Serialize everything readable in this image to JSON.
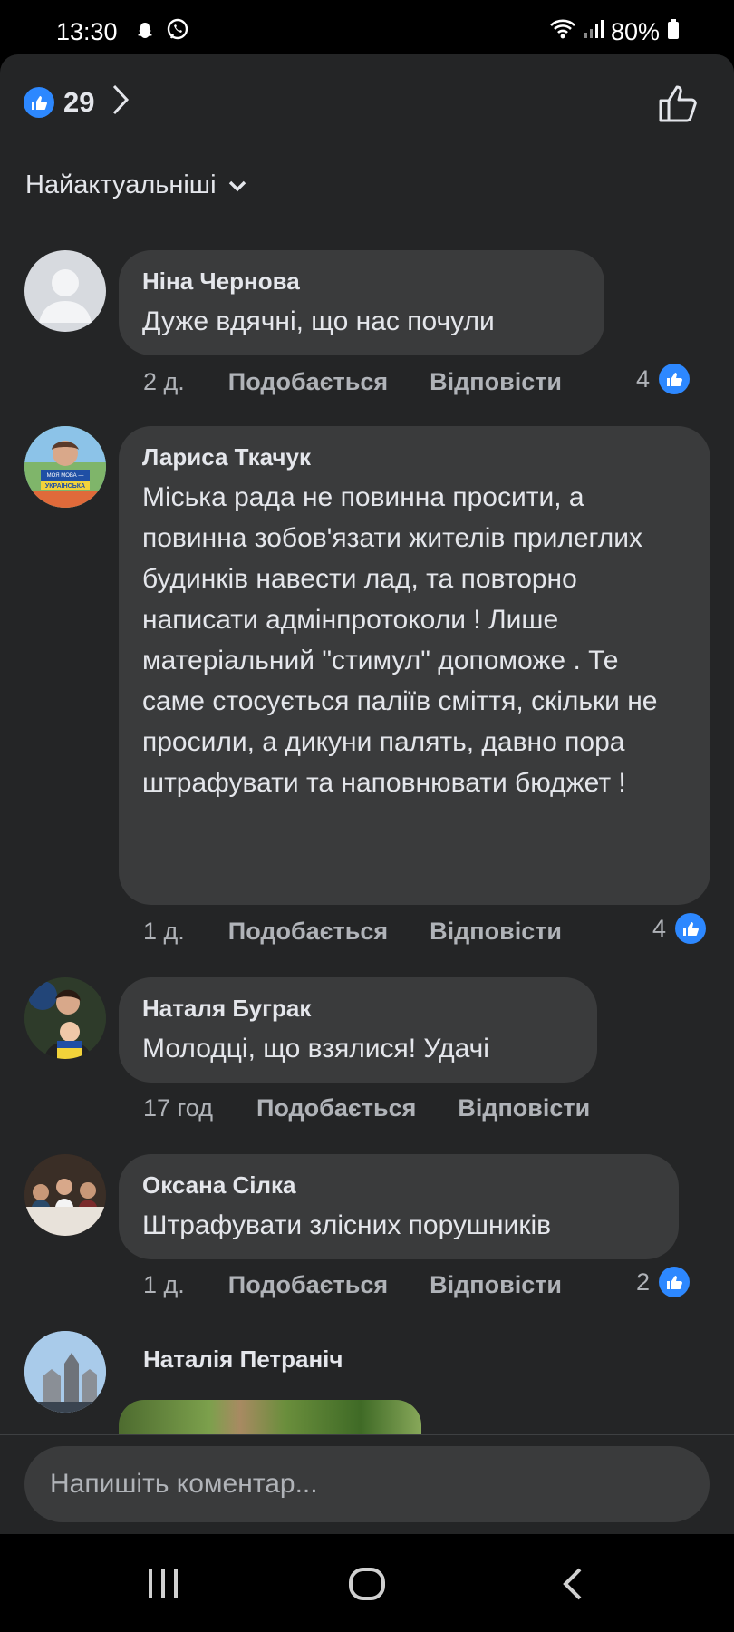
{
  "status_bar": {
    "time": "13:30",
    "left_icons": [
      "snapchat-icon",
      "viber-icon"
    ],
    "right_icons": [
      "wifi-icon",
      "signal-icon"
    ],
    "battery": "80%"
  },
  "header": {
    "reaction_count": "29",
    "reaction_icon": "like-icon",
    "accent": "#2d88ff"
  },
  "sort": {
    "label": "Найактуальніші"
  },
  "comments": [
    {
      "author": "Ніна Чернова",
      "text": "Дуже вдячні, що нас почули",
      "time": "2 д.",
      "like_label": "Подобається",
      "reply_label": "Відповісти",
      "likes": "4"
    },
    {
      "author": "Лариса Ткачук",
      "text": "Міська рада не повинна просити, а повинна зобов'язати жителів прилеглих будинків навести лад, та повторно написати адмінпротоколи ! Лише матеріальний \"стимул\" допоможе . Те саме стосується паліїв сміття, скільки не просили, а дикуни палять, давно пора штрафувати та наповнювати бюджет !",
      "avatar_text": "МОЯ МОВА — УКРАЇНСЬКА",
      "time": "1 д.",
      "like_label": "Подобається",
      "reply_label": "Відповісти",
      "likes": "4"
    },
    {
      "author": "Наталя Буграк",
      "text": "Молодці, що взялися! Удачі",
      "time": "17 год",
      "like_label": "Подобається",
      "reply_label": "Відповісти"
    },
    {
      "author": "Оксана Сілка",
      "text": "Штрафувати злісних порушників",
      "time": "1 д.",
      "like_label": "Подобається",
      "reply_label": "Відповісти",
      "likes": "2"
    },
    {
      "author": "Наталія Петраніч"
    }
  ],
  "composer": {
    "placeholder": "Напишіть коментар..."
  },
  "nav": {
    "icons": [
      "recent-apps-icon",
      "home-icon",
      "back-icon"
    ]
  }
}
